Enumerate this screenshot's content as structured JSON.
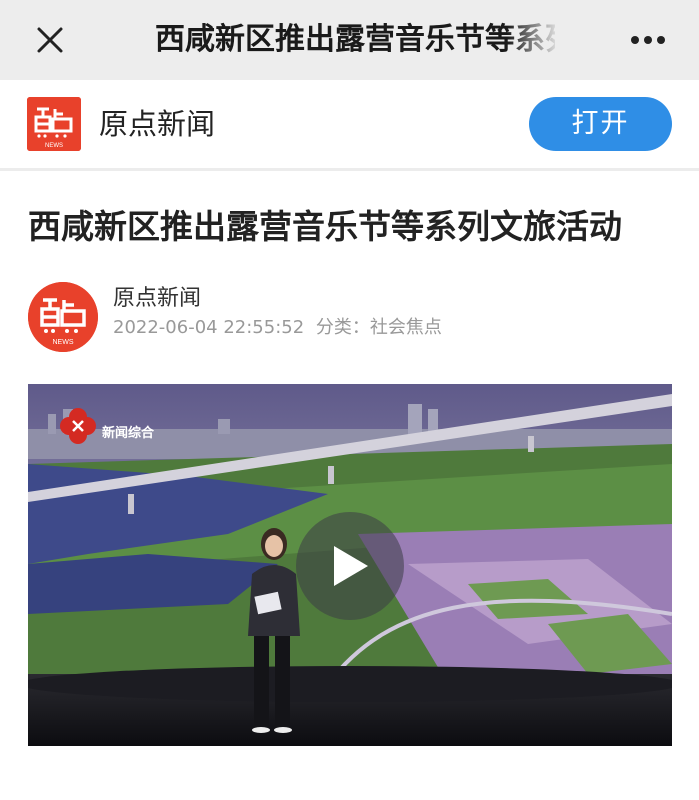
{
  "topbar": {
    "title": "西咸新区推出露营音乐节等系列文旅活动",
    "close_icon": "close-icon",
    "more_icon": "more-dots-icon"
  },
  "banner": {
    "app_name": "原点新闻",
    "open_label": "打开",
    "logo_text": "NEWS"
  },
  "article": {
    "title": "西咸新区推出露营音乐节等系列文旅活动",
    "author": "原点新闻",
    "datetime": "2022-06-04 22:55:52",
    "category_label": "分类：",
    "category": "社会焦点",
    "logo_text": "NEWS"
  },
  "video": {
    "channel_label": "新闻综合",
    "play_icon": "play-icon"
  },
  "colors": {
    "brand_red": "#e8412b",
    "open_button_blue": "#2f8ee6",
    "topbar_bg": "#ededed"
  }
}
